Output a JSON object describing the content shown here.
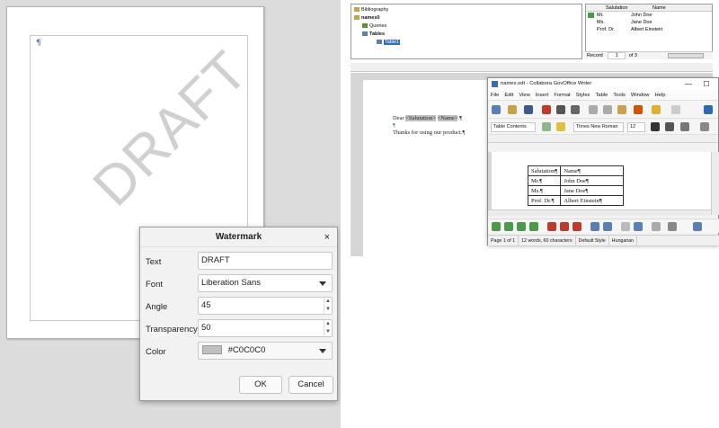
{
  "left": {
    "watermark_text": "DRAFT",
    "paragraph_mark": "¶"
  },
  "dialog": {
    "title": "Watermark",
    "close": "×",
    "text_label": "Text",
    "text_value": "DRAFT",
    "font_label": "Font",
    "font_value": "Liberation Sans",
    "angle_label": "Angle",
    "angle_value": "45",
    "transparency_label": "Transparency",
    "transparency_value": "50",
    "color_label": "Color",
    "color_value": "#C0C0C0",
    "color_swatch": "#c0c0c0",
    "ok_label": "OK",
    "cancel_label": "Cancel"
  },
  "datasource": {
    "tree": [
      "Bibliography",
      "names0",
      "Queries",
      "Tables",
      "Table1"
    ],
    "grid_cols": [
      "Salutation",
      "Name"
    ],
    "grid_rows": [
      [
        "Mr.",
        "John Doe"
      ],
      [
        "Ms.",
        "Jane Doe"
      ],
      [
        "Prof. Dr.",
        "Albert Einstein"
      ]
    ],
    "record_label": "Record",
    "record_value": "1",
    "record_of": "of 3"
  },
  "document": {
    "line1_pre": "Dear ",
    "field_salutation": "<Salutation>",
    "field_name": "<Name>",
    "line1_post": ".¶",
    "line2": "¶",
    "line3": "Thanks for using our product.¶"
  },
  "writer": {
    "title": "names.odt - Collabora GovOffice Writer",
    "minimize": "—",
    "maximize": "☐",
    "menu": [
      "File",
      "Edit",
      "View",
      "Insert",
      "Format",
      "Styles",
      "Table",
      "Tools",
      "Window",
      "Help"
    ],
    "para_style": "Table Contents",
    "font_name": "Times New Roman",
    "font_size": "12",
    "table": [
      [
        "Salutation¶",
        "Name¶"
      ],
      [
        "Mr.¶",
        "John Doe¶"
      ],
      [
        "Ms.¶",
        "Jane Doe¶"
      ],
      [
        "Prof. Dr.¶",
        "Albert Einstein¶"
      ]
    ],
    "status_page": "Page 1 of 1",
    "status_words": "12 words, 60 characters",
    "status_style": "Default Style",
    "status_lang": "Hungarian"
  },
  "colors": {
    "accent": "#2f6fb8",
    "field_bg": "#c0c0c0"
  }
}
